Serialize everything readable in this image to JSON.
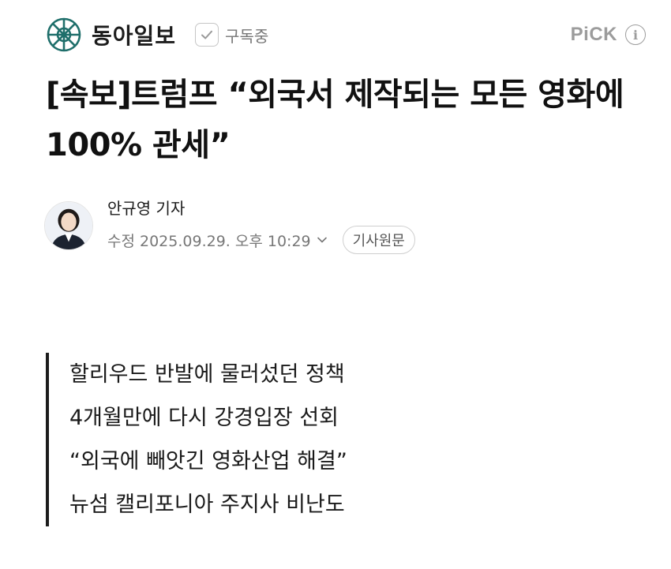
{
  "press": {
    "name": "동아일보",
    "logo_icon": "donga-emblem-icon",
    "logo_color": "#1f6f6b"
  },
  "subscribe": {
    "icon": "check-icon",
    "label": "구독중"
  },
  "pick": {
    "label": "PiCK",
    "info_icon": "ⓘ"
  },
  "article": {
    "headline": "[속보]트럼프 “외국서 제작되는 모든 영화에 100% 관세”",
    "reporter": "안규영 기자",
    "datetime": "수정 2025.09.29. 오후 10:29",
    "original_button": "기사원문"
  },
  "summary": [
    "할리우드 반발에 물러섰던 정책",
    "4개월만에 다시 강경입장 선회",
    "“외국에 빼앗긴 영화산업 해결”",
    "뉴섬 캘리포니아 주지사 비난도"
  ]
}
